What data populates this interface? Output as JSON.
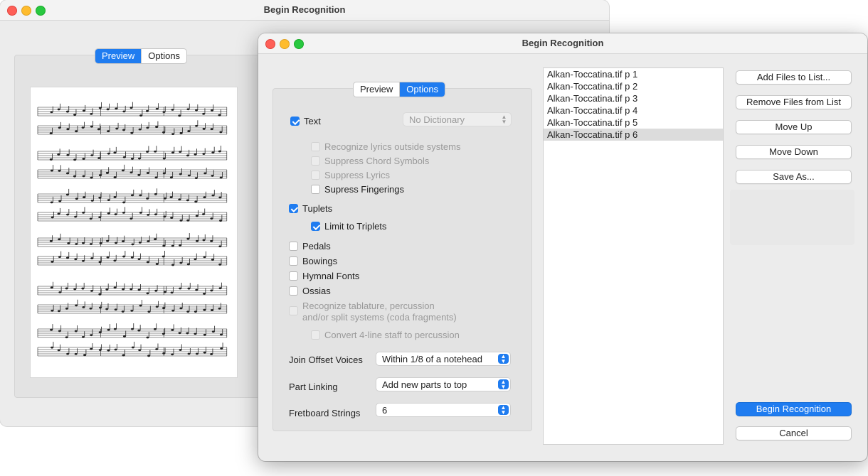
{
  "back_window": {
    "title": "Begin Recognition",
    "tabs": [
      "Preview",
      "Options"
    ],
    "active_tab": 0
  },
  "front_window": {
    "title": "Begin Recognition",
    "tabs": [
      "Preview",
      "Options"
    ],
    "active_tab": 1,
    "options": {
      "text": {
        "label": "Text",
        "checked": true
      },
      "dictionary": {
        "value": "No Dictionary"
      },
      "recognize_lyrics": {
        "label": "Recognize lyrics outside systems",
        "checked": false
      },
      "suppress_chord": {
        "label": "Suppress Chord Symbols",
        "checked": false
      },
      "suppress_lyrics": {
        "label": "Suppress Lyrics",
        "checked": false
      },
      "supress_fingerings": {
        "label": "Supress Fingerings",
        "checked": false
      },
      "tuplets": {
        "label": "Tuplets",
        "checked": true
      },
      "limit_triplets": {
        "label": "Limit to Triplets",
        "checked": true
      },
      "pedals": {
        "label": "Pedals",
        "checked": false
      },
      "bowings": {
        "label": "Bowings",
        "checked": false
      },
      "hymnal_fonts": {
        "label": "Hymnal Fonts",
        "checked": false
      },
      "ossias": {
        "label": "Ossias",
        "checked": false
      },
      "tablature": {
        "label1": "Recognize tablature, percussion",
        "label2": "and/or split systems (coda fragments)",
        "checked": false
      },
      "convert_4line": {
        "label": "Convert 4-line staff to percussion",
        "checked": false
      },
      "join_offset_voices": {
        "label": "Join Offset Voices",
        "value": "Within 1/8 of a notehead"
      },
      "part_linking": {
        "label": "Part Linking",
        "value": "Add new parts to top"
      },
      "fretboard_strings": {
        "label": "Fretboard Strings",
        "value": "6"
      }
    },
    "files": [
      "Alkan-Toccatina.tif p  1",
      "Alkan-Toccatina.tif p  2",
      "Alkan-Toccatina.tif p  3",
      "Alkan-Toccatina.tif p  4",
      "Alkan-Toccatina.tif p  5",
      "Alkan-Toccatina.tif p  6"
    ],
    "selected_file": 5,
    "buttons": {
      "add_files": "Add Files to List...",
      "remove_files": "Remove Files from List",
      "move_up": "Move Up",
      "move_down": "Move Down",
      "save_as": "Save As...",
      "begin": "Begin Recognition",
      "cancel": "Cancel"
    }
  },
  "colors": {
    "accent": "#1f7cf0",
    "close": "#fe5f57",
    "minimize": "#febc2e",
    "zoom": "#28c840"
  }
}
